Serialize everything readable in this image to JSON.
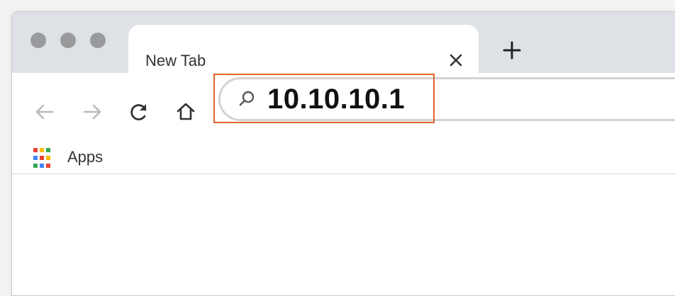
{
  "tab": {
    "title": "New Tab"
  },
  "omnibox": {
    "value": "10.10.10.1"
  },
  "bookmarks": {
    "apps_label": "Apps"
  },
  "colors": {
    "highlight": "#e0632e",
    "traffic_lights": "#999a9c",
    "apps_grid": [
      "#ea4335",
      "#fbbc05",
      "#34a853",
      "#4285f4",
      "#ea4335",
      "#fbbc05",
      "#34a853",
      "#4285f4",
      "#ea4335"
    ]
  },
  "icons": {
    "back": "back-arrow-icon",
    "forward": "forward-arrow-icon",
    "reload": "reload-icon",
    "home": "home-icon",
    "search": "search-icon",
    "close": "close-icon",
    "new_tab": "plus-icon",
    "apps": "apps-grid-icon"
  }
}
